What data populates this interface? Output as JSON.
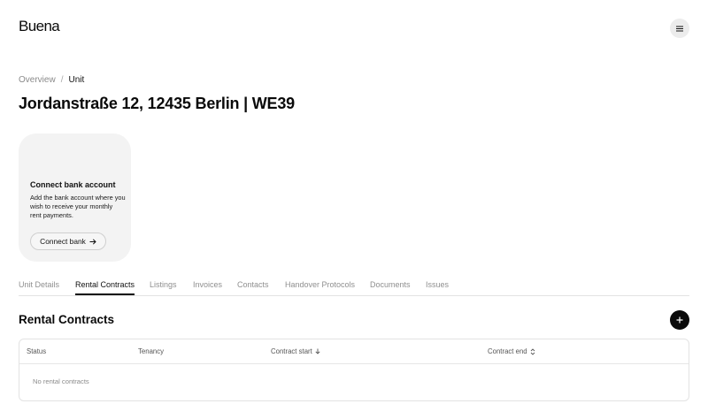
{
  "header": {
    "logo": "Buena",
    "menu_icon": "hamburger-menu-icon"
  },
  "breadcrumb": {
    "items": [
      "Overview",
      "Unit"
    ],
    "separator": "/"
  },
  "page": {
    "title": "Jordanstraße 12, 12435 Berlin | WE39"
  },
  "bank_card": {
    "title": "Connect bank account",
    "description": "Add the bank account where you wish to receive your monthly rent payments.",
    "button_label": "Connect bank",
    "button_icon": "arrow-right-icon"
  },
  "tabs": {
    "items": [
      "Unit Details",
      "Rental Contracts",
      "Listings",
      "Invoices",
      "Contacts",
      "Handover Protocols",
      "Documents",
      "Issues"
    ],
    "active": "Rental Contracts"
  },
  "rental_contracts": {
    "title": "Rental Contracts",
    "add_icon": "plus-icon",
    "columns": [
      "Status",
      "Tenancy",
      "Contract start",
      "Contract end"
    ],
    "sort": {
      "Contract start": "descending",
      "Contract end": "sortable"
    },
    "empty_text": "No rental contracts"
  },
  "colors": {
    "text": "#111111",
    "muted": "#8a8a8a",
    "card_bg": "#f3f3f3",
    "accent": "#0b0b0b",
    "border": "#e3e3e3"
  }
}
